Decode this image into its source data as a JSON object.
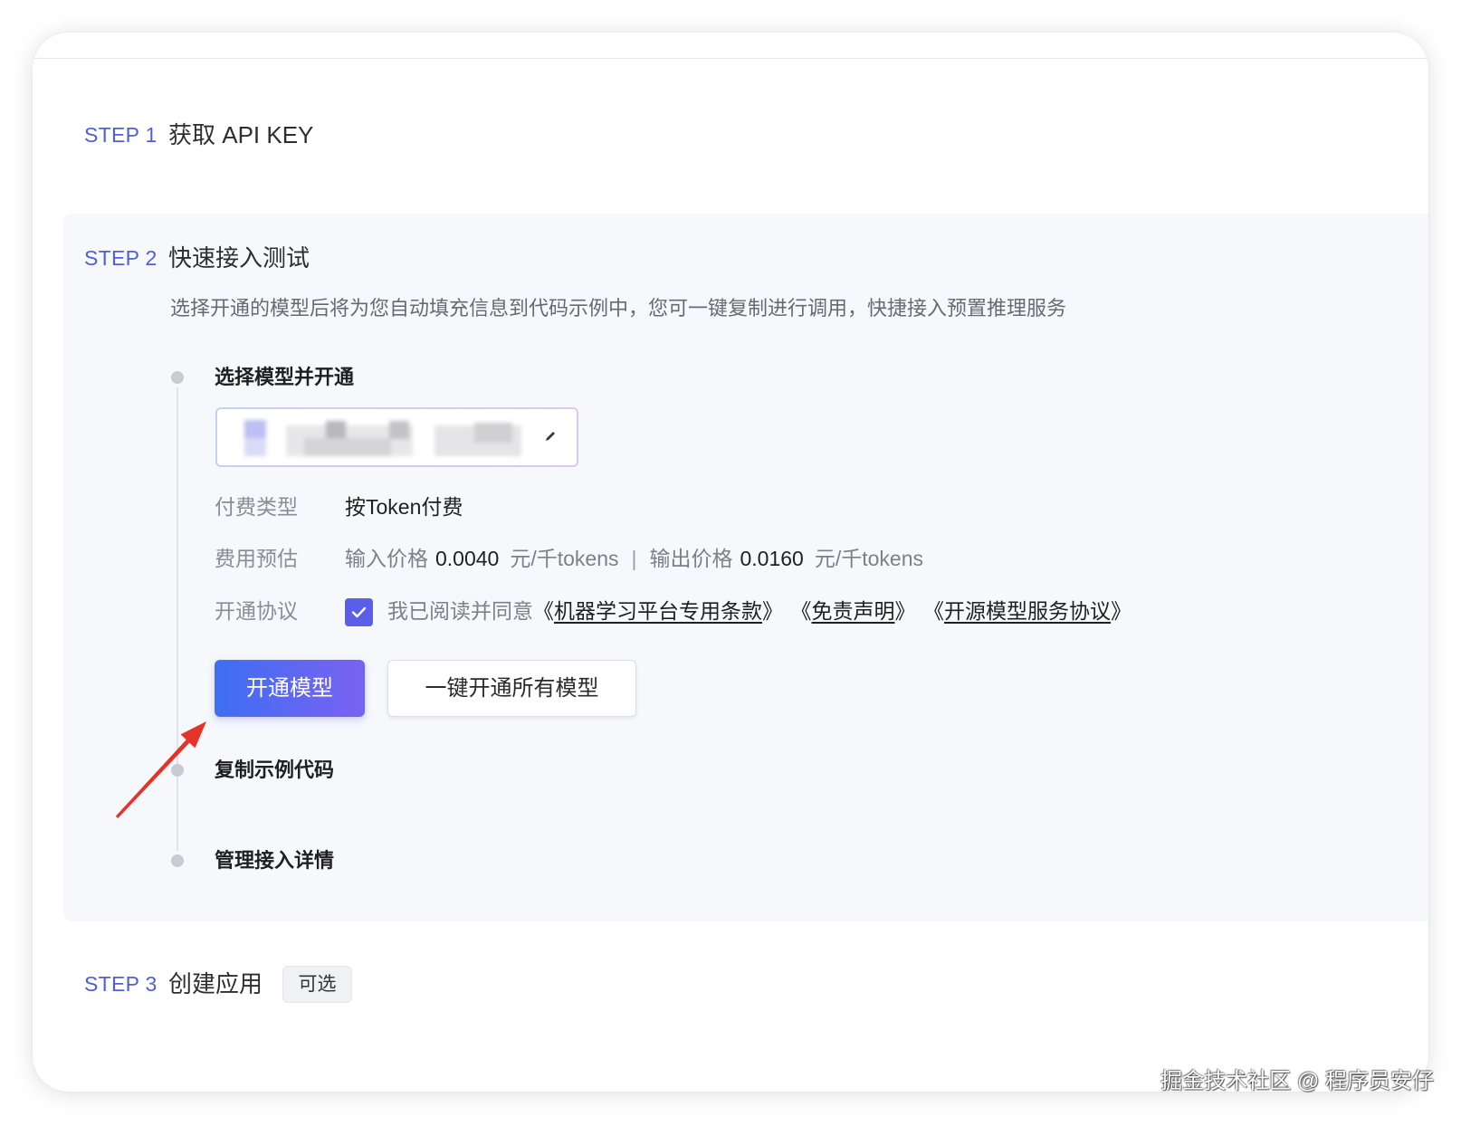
{
  "steps": {
    "step1": {
      "label": "STEP 1",
      "title": "获取 API KEY"
    },
    "step2": {
      "label": "STEP 2",
      "title": "快速接入测试",
      "description": "选择开通的模型后将为您自动填充信息到代码示例中，您可一键复制进行调用，快捷接入预置推理服务"
    },
    "step3": {
      "label": "STEP 3",
      "title": "创建应用",
      "badge": "可选"
    }
  },
  "quick_access": {
    "substeps": [
      {
        "label": "选择模型并开通"
      },
      {
        "label": "复制示例代码"
      },
      {
        "label": "管理接入详情"
      }
    ],
    "billing": {
      "label": "付费类型",
      "value": "按Token付费"
    },
    "cost": {
      "label": "费用预估",
      "input_label": "输入价格",
      "input_price": "0.0040",
      "input_unit": "元/千tokens",
      "separator": "|",
      "output_label": "输出价格",
      "output_price": "0.0160",
      "output_unit": "元/千tokens"
    },
    "agreement": {
      "label": "开通协议",
      "checked": true,
      "prefix": "我已阅读并同意",
      "bracket_open": "《",
      "bracket_close": "》",
      "items": [
        {
          "name": "机器学习平台专用条款"
        },
        {
          "name": "免责声明"
        },
        {
          "name": "开源模型服务协议"
        }
      ]
    },
    "buttons": {
      "activate": "开通模型",
      "activate_all": "一键开通所有模型"
    }
  },
  "watermark": "掘金技术社区 @ 程序员安仔",
  "icons": {
    "model_select": "pencil-icon",
    "agreement_checkbox": "check-icon"
  },
  "colors": {
    "accent": "#4f5fd6",
    "primary_start": "#3d6ef2",
    "primary_end": "#7b61f3",
    "checkbox": "#5a5ee8",
    "arrow": "#e5332a",
    "panel_bg": "#f7f8fc"
  }
}
